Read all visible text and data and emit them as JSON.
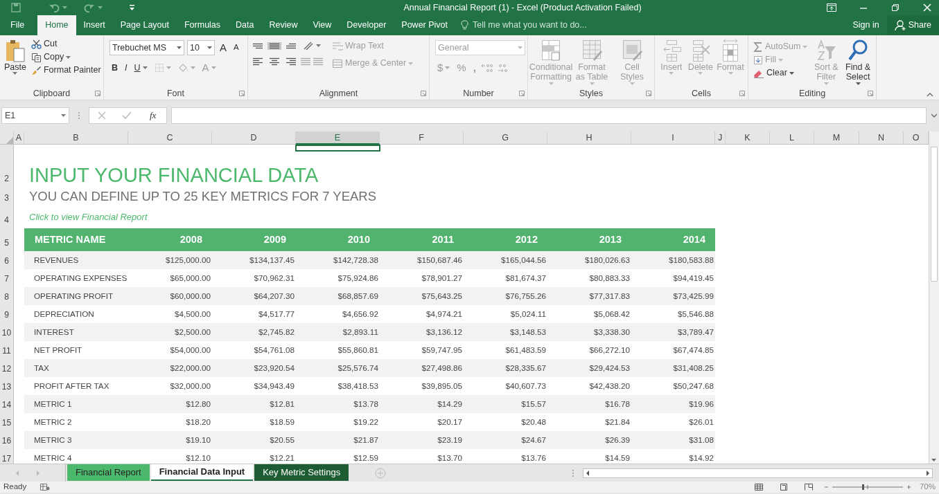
{
  "window": {
    "title": "Annual Financial Report (1) - Excel (Product Activation Failed)"
  },
  "menu_tabs": [
    {
      "label": "File",
      "selected": false
    },
    {
      "label": "Home",
      "selected": true
    },
    {
      "label": "Insert",
      "selected": false
    },
    {
      "label": "Page Layout",
      "selected": false
    },
    {
      "label": "Formulas",
      "selected": false
    },
    {
      "label": "Data",
      "selected": false
    },
    {
      "label": "Review",
      "selected": false
    },
    {
      "label": "View",
      "selected": false
    },
    {
      "label": "Developer",
      "selected": false
    },
    {
      "label": "Power Pivot",
      "selected": false
    }
  ],
  "tell_me": {
    "placeholder": "Tell me what you want to do..."
  },
  "sign_in": "Sign in",
  "share": "Share",
  "ribbon": {
    "clipboard": {
      "label": "Clipboard",
      "paste": "Paste",
      "cut": "Cut",
      "copy": "Copy",
      "format_painter": "Format Painter"
    },
    "font": {
      "label": "Font",
      "font_name": "Trebuchet MS",
      "font_size": "10",
      "grow": "A",
      "shrink": "A",
      "bold": "B",
      "italic": "I",
      "underline": "U",
      "font_color": "A"
    },
    "alignment": {
      "label": "Alignment",
      "vertical_align": [
        {
          "selected": false
        },
        {
          "selected": true
        },
        {
          "selected": false
        }
      ],
      "wrap_text": {
        "label": "Wrap Text",
        "disabled": true
      },
      "merge": {
        "label": "Merge & Center",
        "disabled": true
      }
    },
    "number": {
      "label": "Number",
      "disabled": true,
      "format": "General",
      "currency": "$",
      "percent": "%",
      "comma": ","
    },
    "styles": {
      "label": "Styles",
      "buttons": [
        {
          "label": "Conditional Formatting",
          "disabled": true
        },
        {
          "label": "Format as Table",
          "disabled": true
        },
        {
          "label": "Cell Styles",
          "disabled": true
        }
      ]
    },
    "cells": {
      "label": "Cells",
      "buttons": [
        {
          "label": "Insert",
          "disabled": true
        },
        {
          "label": "Delete",
          "disabled": true
        },
        {
          "label": "Format",
          "disabled": true
        }
      ]
    },
    "editing": {
      "label": "Editing",
      "autosum": {
        "label": "AutoSum",
        "disabled": true
      },
      "fill": {
        "label": "Fill",
        "disabled": true
      },
      "clear": {
        "label": "Clear",
        "disabled": false
      },
      "sort": {
        "label": "Sort & Filter",
        "disabled": true
      },
      "find": {
        "label": "Find & Select",
        "disabled": false
      }
    }
  },
  "formula_bar": {
    "name_box": "E1",
    "function_label": "fx"
  },
  "sheet": {
    "columns": [
      {
        "label": "A",
        "selected": false
      },
      {
        "label": "B",
        "selected": false
      },
      {
        "label": "C",
        "selected": false
      },
      {
        "label": "D",
        "selected": false
      },
      {
        "label": "E",
        "selected": true
      },
      {
        "label": "F",
        "selected": false
      },
      {
        "label": "G",
        "selected": false
      },
      {
        "label": "H",
        "selected": false
      },
      {
        "label": "I",
        "selected": false
      },
      {
        "label": "J",
        "selected": false
      },
      {
        "label": "K",
        "selected": false
      },
      {
        "label": "L",
        "selected": false
      },
      {
        "label": "M",
        "selected": false
      },
      {
        "label": "N",
        "selected": false
      },
      {
        "label": "O",
        "selected": false
      }
    ],
    "row_headers": [
      "2",
      "3",
      "4",
      "5",
      "6",
      "7",
      "8",
      "9",
      "10",
      "11",
      "12",
      "13",
      "14",
      "15",
      "16",
      "17"
    ],
    "heading": "INPUT YOUR FINANCIAL DATA",
    "subheading": "YOU CAN DEFINE UP TO 25 KEY METRICS FOR 7 YEARS",
    "link": "Click to view Financial Report",
    "table": {
      "columns": [
        "METRIC NAME",
        "2008",
        "2009",
        "2010",
        "2011",
        "2012",
        "2013",
        "2014"
      ],
      "rows": [
        [
          "REVENUES",
          "$125,000.00",
          "$134,137.45",
          "$142,728.38",
          "$150,687.46",
          "$165,044.56",
          "$180,026.63",
          "$180,583.88"
        ],
        [
          "OPERATING EXPENSES",
          "$65,000.00",
          "$70,962.31",
          "$75,924.86",
          "$78,901.27",
          "$81,674.37",
          "$80,883.33",
          "$94,419.45"
        ],
        [
          "OPERATING PROFIT",
          "$60,000.00",
          "$64,207.30",
          "$68,857.69",
          "$75,643.25",
          "$76,755.26",
          "$77,317.83",
          "$73,425.99"
        ],
        [
          "DEPRECIATION",
          "$4,500.00",
          "$4,517.77",
          "$4,656.92",
          "$4,974.21",
          "$5,024.11",
          "$5,068.42",
          "$5,546.88"
        ],
        [
          "INTEREST",
          "$2,500.00",
          "$2,745.82",
          "$2,893.11",
          "$3,136.12",
          "$3,148.53",
          "$3,338.30",
          "$3,789.47"
        ],
        [
          "NET PROFIT",
          "$54,000.00",
          "$54,761.08",
          "$55,860.81",
          "$59,747.95",
          "$61,483.59",
          "$66,272.10",
          "$67,474.85"
        ],
        [
          "TAX",
          "$22,000.00",
          "$23,920.54",
          "$25,576.74",
          "$27,498.86",
          "$28,335.67",
          "$29,424.53",
          "$31,408.25"
        ],
        [
          "PROFIT AFTER TAX",
          "$32,000.00",
          "$34,943.49",
          "$38,418.53",
          "$39,895.05",
          "$40,607.73",
          "$42,438.20",
          "$50,247.68"
        ],
        [
          "METRIC 1",
          "$12.80",
          "$12.81",
          "$13.78",
          "$14.29",
          "$15.57",
          "$16.78",
          "$19.96"
        ],
        [
          "METRIC 2",
          "$18.20",
          "$18.59",
          "$19.22",
          "$20.17",
          "$20.48",
          "$21.84",
          "$26.01"
        ],
        [
          "METRIC 3",
          "$19.10",
          "$20.55",
          "$21.87",
          "$23.19",
          "$24.67",
          "$26.39",
          "$31.08"
        ],
        [
          "METRIC 4",
          "$12.10",
          "$12.21",
          "$12.59",
          "$13.70",
          "$13.76",
          "$14.59",
          "$14.92"
        ]
      ]
    }
  },
  "sheet_tabs": [
    {
      "label": "Financial Report",
      "selected": false,
      "color": "#4cb86b"
    },
    {
      "label": "Financial Data Input",
      "selected": true,
      "color": "#217346"
    },
    {
      "label": "Key Metric Settings",
      "selected": false,
      "color": "#1e5c34"
    }
  ],
  "status_bar": {
    "status": "Ready",
    "zoom": "70%"
  }
}
